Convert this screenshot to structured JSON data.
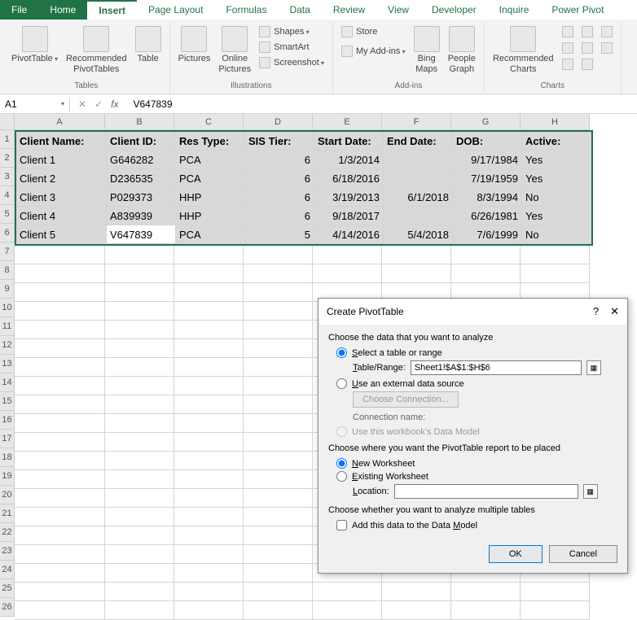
{
  "tabs": {
    "file": "File",
    "home": "Home",
    "insert": "Insert",
    "pageLayout": "Page Layout",
    "formulas": "Formulas",
    "data": "Data",
    "review": "Review",
    "view": "View",
    "developer": "Developer",
    "inquire": "Inquire",
    "powerPivot": "Power Pivot"
  },
  "ribbon": {
    "tables": {
      "label": "Tables",
      "pivotTable": "PivotTable",
      "recommended": "Recommended\nPivotTables",
      "table": "Table"
    },
    "illustrations": {
      "label": "Illustrations",
      "pictures": "Pictures",
      "onlinePictures": "Online\nPictures",
      "shapes": "Shapes",
      "smartart": "SmartArt",
      "screenshot": "Screenshot"
    },
    "addins": {
      "label": "Add-ins",
      "store": "Store",
      "myaddins": "My Add-ins",
      "bing": "Bing\nMaps",
      "people": "People\nGraph"
    },
    "charts": {
      "label": "Charts",
      "recommended": "Recommended\nCharts"
    }
  },
  "nameBox": "A1",
  "formula": "V647839",
  "columns": [
    "A",
    "B",
    "C",
    "D",
    "E",
    "F",
    "G",
    "H"
  ],
  "rowNums": [
    1,
    2,
    3,
    4,
    5,
    6,
    7,
    8,
    9,
    10,
    11,
    12,
    13,
    14,
    15,
    16,
    17,
    18,
    19,
    20,
    21,
    22,
    23,
    24,
    25,
    26
  ],
  "headers": [
    "Client Name:",
    "Client ID:",
    "Res Type:",
    "SIS Tier:",
    "Start Date:",
    "End Date:",
    "DOB:",
    "Active:"
  ],
  "rows": [
    [
      "Client 1",
      "G646282",
      "PCA",
      "6",
      "1/3/2014",
      "",
      "9/17/1984",
      "Yes"
    ],
    [
      "Client 2",
      "D236535",
      "PCA",
      "6",
      "6/18/2016",
      "",
      "7/19/1959",
      "Yes"
    ],
    [
      "Client 3",
      "P029373",
      "HHP",
      "6",
      "3/19/2013",
      "6/1/2018",
      "8/3/1994",
      "No"
    ],
    [
      "Client 4",
      "A839939",
      "HHP",
      "6",
      "9/18/2017",
      "",
      "6/26/1981",
      "Yes"
    ],
    [
      "Client 5",
      "V647839",
      "PCA",
      "5",
      "4/14/2016",
      "5/4/2018",
      "7/6/1999",
      "No"
    ]
  ],
  "numericCols": [
    3,
    4,
    5,
    6
  ],
  "dialog": {
    "title": "Create PivotTable",
    "chooseData": "Choose the data that you want to analyze",
    "selectRange": "Select a table or range",
    "tableRangeLbl": "Table/Range:",
    "tableRangeVal": "Sheet1!$A$1:$H$6",
    "useExternal": "Use an external data source",
    "chooseConn": "Choose Connection...",
    "connName": "Connection name:",
    "useDataModel": "Use this workbook's Data Model",
    "chooseWhere": "Choose where you want the PivotTable report to be placed",
    "newWs": "New Worksheet",
    "existingWs": "Existing Worksheet",
    "locationLbl": "Location:",
    "multiTables": "Choose whether you want to analyze multiple tables",
    "addToModel": "Add this data to the Data Model",
    "ok": "OK",
    "cancel": "Cancel"
  }
}
